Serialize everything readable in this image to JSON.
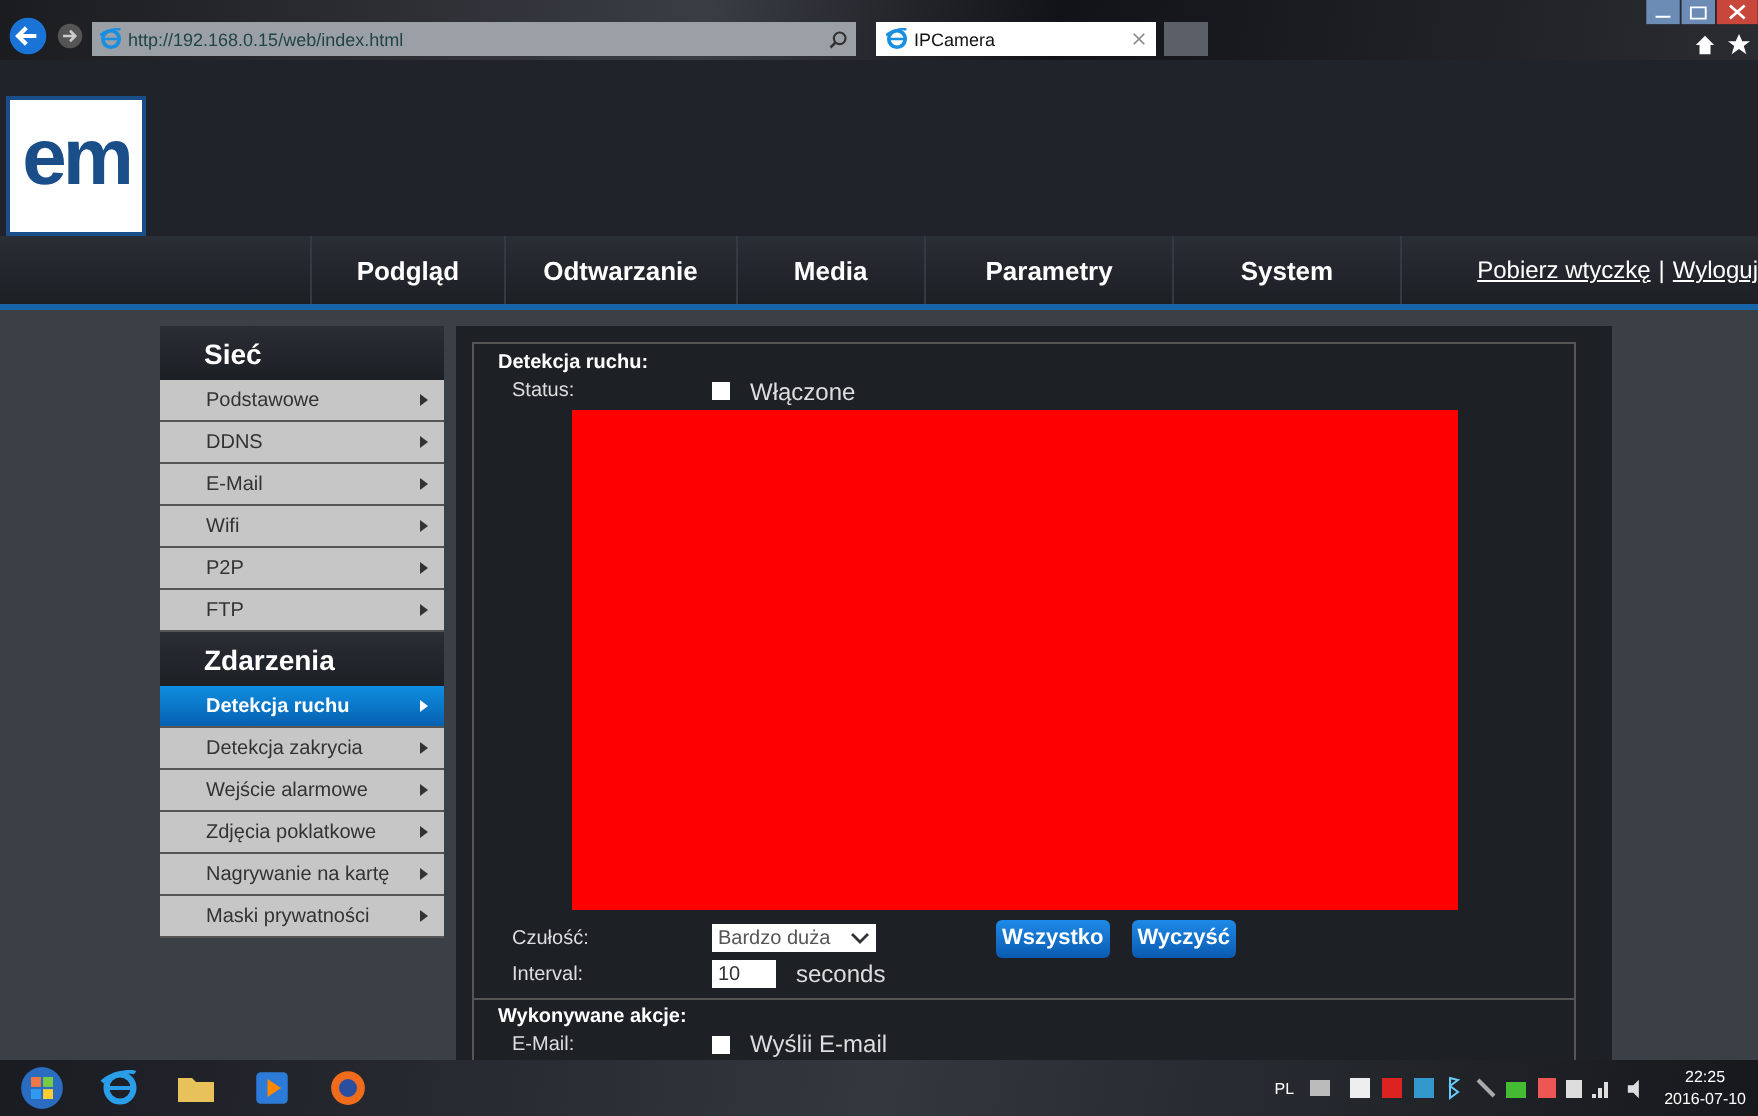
{
  "browser": {
    "url": "http://192.168.0.15/web/index.html",
    "tab_title": "IPCamera"
  },
  "header": {
    "logo": "em"
  },
  "nav": {
    "items": [
      "Podgląd",
      "Odtwarzanie",
      "Media",
      "Parametry",
      "System"
    ],
    "links": [
      "Pobierz wtyczkę",
      "Wyloguj"
    ],
    "separator": "|"
  },
  "sidebar": [
    {
      "title": "Sieć",
      "items": [
        {
          "label": "Podstawowe",
          "selected": false
        },
        {
          "label": "DDNS",
          "selected": false
        },
        {
          "label": "E-Mail",
          "selected": false
        },
        {
          "label": "Wifi",
          "selected": false
        },
        {
          "label": "P2P",
          "selected": false
        },
        {
          "label": "FTP",
          "selected": false
        }
      ]
    },
    {
      "title": "Zdarzenia",
      "items": [
        {
          "label": "Detekcja ruchu",
          "selected": true
        },
        {
          "label": "Detekcja zakrycia",
          "selected": false
        },
        {
          "label": "Wejście alarmowe",
          "selected": false
        },
        {
          "label": "Zdjęcia poklatkowe",
          "selected": false
        },
        {
          "label": "Nagrywanie na kartę",
          "selected": false
        },
        {
          "label": "Maski prywatności",
          "selected": false
        }
      ]
    }
  ],
  "content": {
    "heading": "Detekcja ruchu:",
    "status": {
      "label": "Status:",
      "checked": false,
      "text": "Włączone"
    },
    "sensitivity": {
      "label": "Czułość:",
      "value": "Bardzo duża"
    },
    "buttons": [
      "Wszystko",
      "Wyczyść"
    ],
    "interval": {
      "label": "Interval:",
      "value": "10",
      "unit": "seconds"
    },
    "actions_heading": "Wykonywane akcje:",
    "email": {
      "label": "E-Mail:",
      "checked": false,
      "text": "Wyślii E-mail"
    }
  },
  "taskbar": {
    "language": "PL",
    "time": "22:25",
    "date": "2016-07-10"
  }
}
